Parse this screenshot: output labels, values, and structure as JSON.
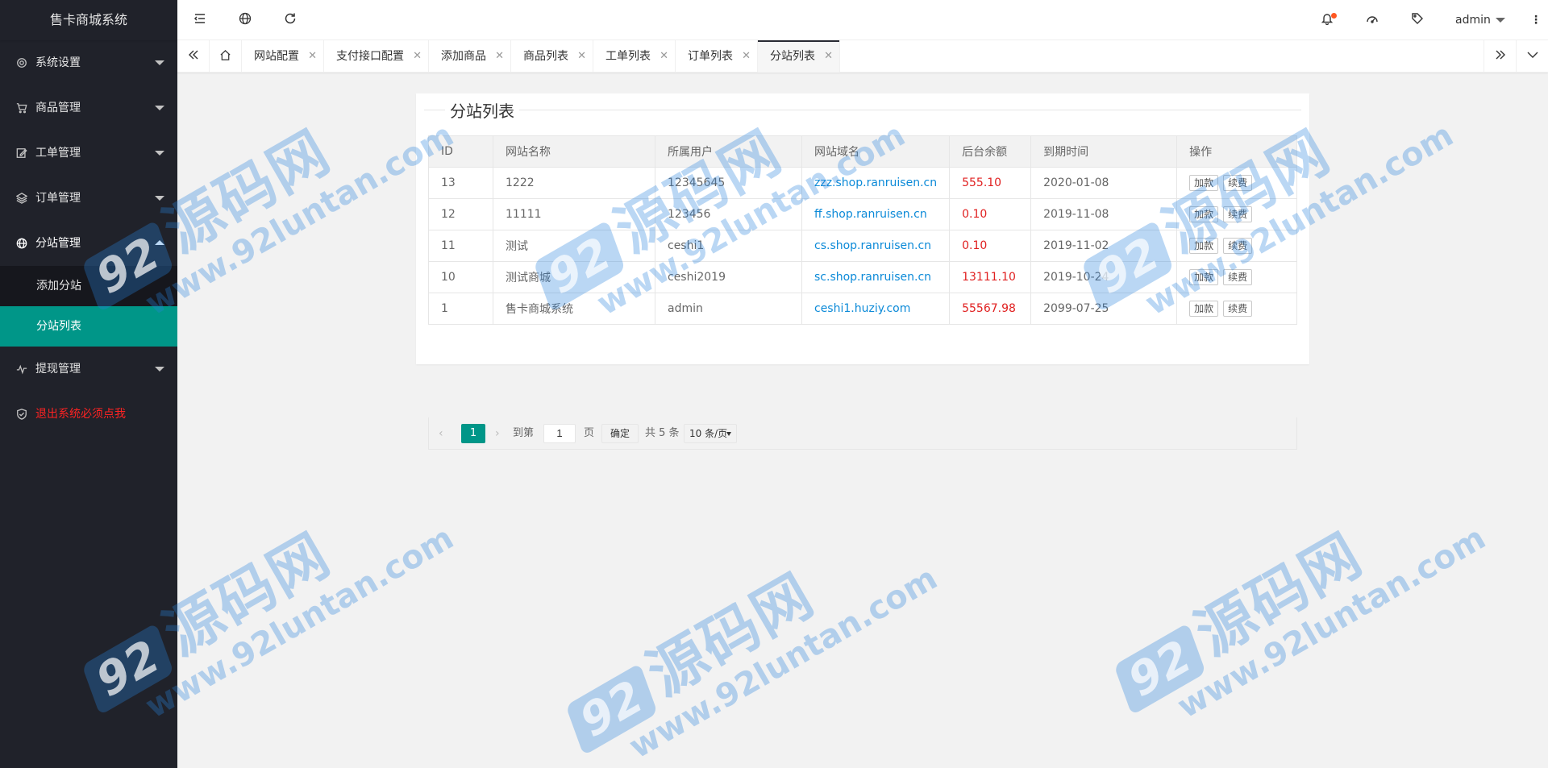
{
  "sidebar": {
    "title": "售卡商城系统",
    "items": [
      {
        "label": "系统设置",
        "icon": "gear-icon"
      },
      {
        "label": "商品管理",
        "icon": "cart-icon"
      },
      {
        "label": "工单管理",
        "icon": "edit-icon"
      },
      {
        "label": "订单管理",
        "icon": "layers-icon"
      },
      {
        "label": "分站管理",
        "icon": "globe-icon"
      },
      {
        "label": "提现管理",
        "icon": "pulse-icon"
      },
      {
        "label": "退出系统必须点我",
        "icon": "shield-icon"
      }
    ],
    "sub_items": [
      {
        "label": "添加分站"
      },
      {
        "label": "分站列表"
      }
    ]
  },
  "header": {
    "user": "admin"
  },
  "tabs": [
    {
      "label": "网站配置"
    },
    {
      "label": "支付接口配置"
    },
    {
      "label": "添加商品"
    },
    {
      "label": "商品列表"
    },
    {
      "label": "工单列表"
    },
    {
      "label": "订单列表"
    },
    {
      "label": "分站列表"
    }
  ],
  "panel": {
    "title": "分站列表",
    "columns": [
      "ID",
      "网站名称",
      "所属用户",
      "网站域名",
      "后台余额",
      "到期时间",
      "操作"
    ],
    "rows": [
      {
        "id": "13",
        "name": "1222",
        "user": "12345645",
        "domain": "zzz.shop.ranruisen.cn",
        "balance": "555.10",
        "expire": "2020-01-08"
      },
      {
        "id": "12",
        "name": "11111",
        "user": "123456",
        "domain": "ff.shop.ranruisen.cn",
        "balance": "0.10",
        "expire": "2019-11-08"
      },
      {
        "id": "11",
        "name": "测试",
        "user": "ceshi1",
        "domain": "cs.shop.ranruisen.cn",
        "balance": "0.10",
        "expire": "2019-11-02"
      },
      {
        "id": "10",
        "name": "测试商城",
        "user": "ceshi2019",
        "domain": "sc.shop.ranruisen.cn",
        "balance": "13111.10",
        "expire": "2019-10-24"
      },
      {
        "id": "1",
        "name": "售卡商城系统",
        "user": "admin",
        "domain": "ceshi1.huziy.com",
        "balance": "55567.98",
        "expire": "2099-07-25"
      }
    ],
    "action_add": "加款",
    "action_renew": "续费",
    "pager": {
      "current": "1",
      "goto_label": "到第",
      "goto_value": "1",
      "page_label": "页",
      "confirm": "确定",
      "total": "共 5 条",
      "per_page": "10 条/页"
    }
  },
  "watermark": {
    "badge": "92",
    "cn": "源码网",
    "url": "www.92luntan.com"
  },
  "colors": {
    "sidebar_bg": "#20222a",
    "accent": "#009688",
    "link": "#0c8ad8",
    "balance": "#e02020",
    "logout": "#ff2222"
  }
}
